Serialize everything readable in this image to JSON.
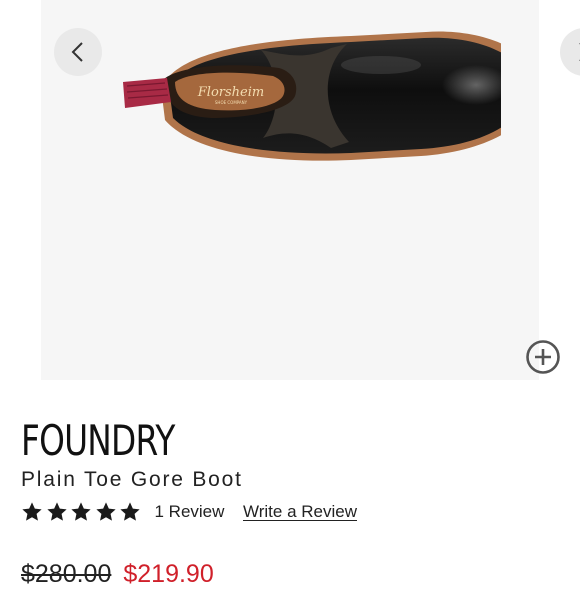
{
  "product": {
    "brand": "FOUNDRY",
    "name": "Plain Toe Gore Boot",
    "insole_logo": "Florsheim",
    "insole_tagline": "SHOE COMPANY"
  },
  "rating": {
    "stars": 5,
    "max_stars": 5,
    "review_count_label": "1 Review",
    "write_review_label": "Write a Review"
  },
  "price": {
    "original": "$280.00",
    "sale": "$219.90"
  },
  "gallery": {
    "prev_icon": "chevron-left-icon",
    "next_icon": "chevron-right-icon",
    "zoom_icon": "zoom-plus-icon"
  },
  "colors": {
    "sale_price": "#d0202a",
    "gallery_bg": "#f6f6f6",
    "nav_button_bg": "#e9e9e9",
    "boot_leather": "#111111",
    "insole": "#a5683d",
    "pull_tab": "#a82a45"
  }
}
